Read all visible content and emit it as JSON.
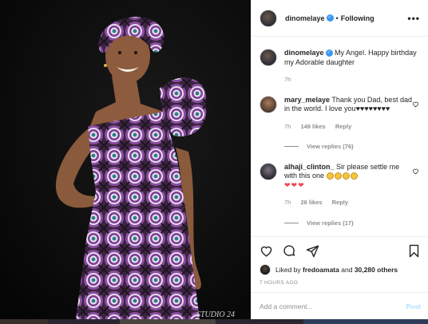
{
  "post": {
    "username": "dinomelaye",
    "follow_status": "Following",
    "more_icon": "more-horizontal-icon",
    "caption_username": "dinomelaye",
    "caption_text": "My Angel. Happy birthday my Adorable daughter",
    "caption_age": "7h"
  },
  "comments": [
    {
      "username": "mary_melaye",
      "text": "Thank you Dad, best dad in the world. I love you",
      "hearts": "♥♥♥♥♥♥♥♥",
      "age": "7h",
      "likes": "149 likes",
      "reply": "Reply",
      "view_replies": "View replies (76)"
    },
    {
      "username": "alhaji_clinton_",
      "text": "Sir please settle me with this one",
      "hearts": "❤❤❤",
      "age": "7h",
      "likes": "26 likes",
      "reply": "Reply",
      "view_replies": "View replies (17)"
    }
  ],
  "actions": {
    "liked_by_prefix": "Liked by",
    "liked_by_user": "fredoamata",
    "liked_by_suffix": "and",
    "liked_by_count": "30,280 others",
    "time_ago": "7 HOURS AGO"
  },
  "add_comment": {
    "placeholder": "Add a comment...",
    "post_label": "Post"
  },
  "photo": {
    "watermark": "STUDIO 24"
  },
  "colors": {
    "accent": "#3897f0",
    "heart_red": "#ed4956",
    "dress_purple": "#8a4fa0",
    "dress_teal": "#2c7f86"
  }
}
